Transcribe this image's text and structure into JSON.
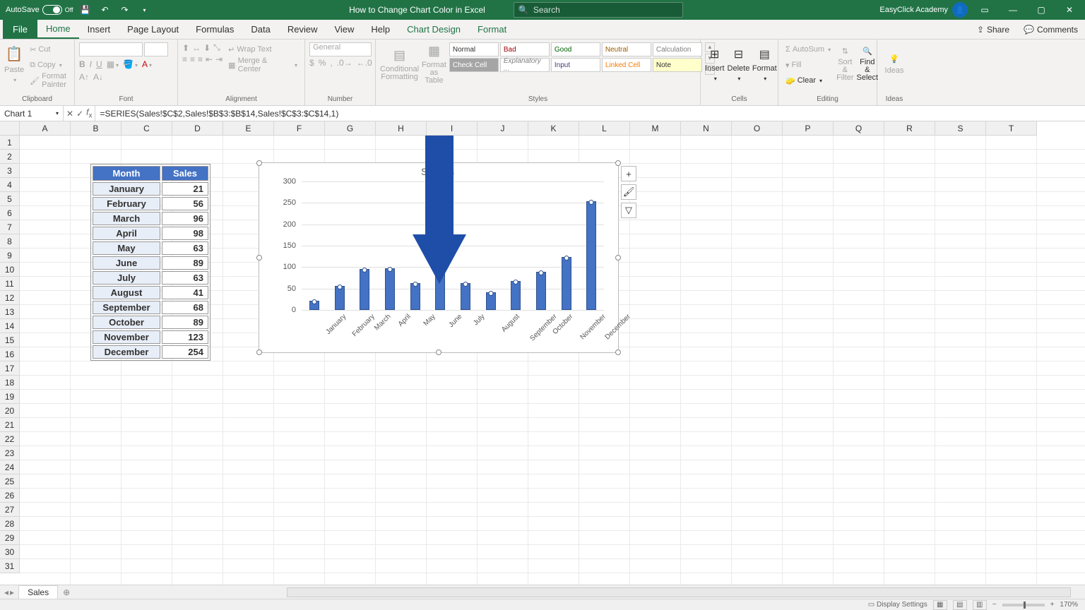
{
  "titlebar": {
    "autosave": "AutoSave",
    "autosave_state": "Off",
    "doc_title": "How to Change Chart Color in Excel",
    "search_placeholder": "Search",
    "account": "EasyClick Academy"
  },
  "tabs": {
    "file": "File",
    "home": "Home",
    "insert": "Insert",
    "page_layout": "Page Layout",
    "formulas": "Formulas",
    "data": "Data",
    "review": "Review",
    "view": "View",
    "help": "Help",
    "chart_design": "Chart Design",
    "format": "Format",
    "share": "Share",
    "comments": "Comments"
  },
  "ribbon": {
    "clipboard": {
      "label": "Clipboard",
      "paste": "Paste",
      "cut": "Cut",
      "copy": "Copy",
      "format_painter": "Format Painter"
    },
    "font": {
      "label": "Font"
    },
    "alignment": {
      "label": "Alignment",
      "wrap": "Wrap Text",
      "merge": "Merge & Center"
    },
    "number": {
      "label": "Number",
      "format": "General"
    },
    "styles": {
      "label": "Styles",
      "cond": "Conditional Formatting",
      "table": "Format as Table",
      "cells": [
        "Normal",
        "Bad",
        "Good",
        "Neutral",
        "Calculation",
        "Check Cell",
        "Explanatory ...",
        "Input",
        "Linked Cell",
        "Note"
      ]
    },
    "cells": {
      "label": "Cells",
      "insert": "Insert",
      "delete": "Delete",
      "format": "Format"
    },
    "editing": {
      "label": "Editing",
      "autosum": "AutoSum",
      "fill": "Fill",
      "clear": "Clear",
      "sort": "Sort & Filter",
      "find": "Find & Select"
    },
    "ideas": {
      "label": "Ideas",
      "ideas": "Ideas"
    }
  },
  "namebox": "Chart 1",
  "formula": "=SERIES(Sales!$C$2,Sales!$B$3:$B$14,Sales!$C$3:$C$14,1)",
  "columns": [
    "A",
    "B",
    "C",
    "D",
    "E",
    "F",
    "G",
    "H",
    "I",
    "J",
    "K",
    "L",
    "M",
    "N",
    "O",
    "P",
    "Q",
    "R",
    "S",
    "T"
  ],
  "row_count": 31,
  "table": {
    "headers": [
      "Month",
      "Sales"
    ],
    "rows": [
      [
        "January",
        "21"
      ],
      [
        "February",
        "56"
      ],
      [
        "March",
        "96"
      ],
      [
        "April",
        "98"
      ],
      [
        "May",
        "63"
      ],
      [
        "June",
        "89"
      ],
      [
        "July",
        "63"
      ],
      [
        "August",
        "41"
      ],
      [
        "September",
        "68"
      ],
      [
        "October",
        "89"
      ],
      [
        "November",
        "123"
      ],
      [
        "December",
        "254"
      ]
    ]
  },
  "chart_data": {
    "type": "bar",
    "title": "Sales",
    "categories": [
      "January",
      "February",
      "March",
      "April",
      "May",
      "June",
      "July",
      "August",
      "September",
      "October",
      "November",
      "December"
    ],
    "values": [
      21,
      56,
      96,
      98,
      63,
      89,
      63,
      41,
      68,
      89,
      123,
      254
    ],
    "ylim": [
      0,
      300
    ],
    "y_ticks": [
      0,
      50,
      100,
      150,
      200,
      250,
      300
    ],
    "xlabel": "",
    "ylabel": ""
  },
  "sheet_tabs": [
    "Sales"
  ],
  "status": {
    "display_settings": "Display Settings",
    "zoom": "170%"
  }
}
